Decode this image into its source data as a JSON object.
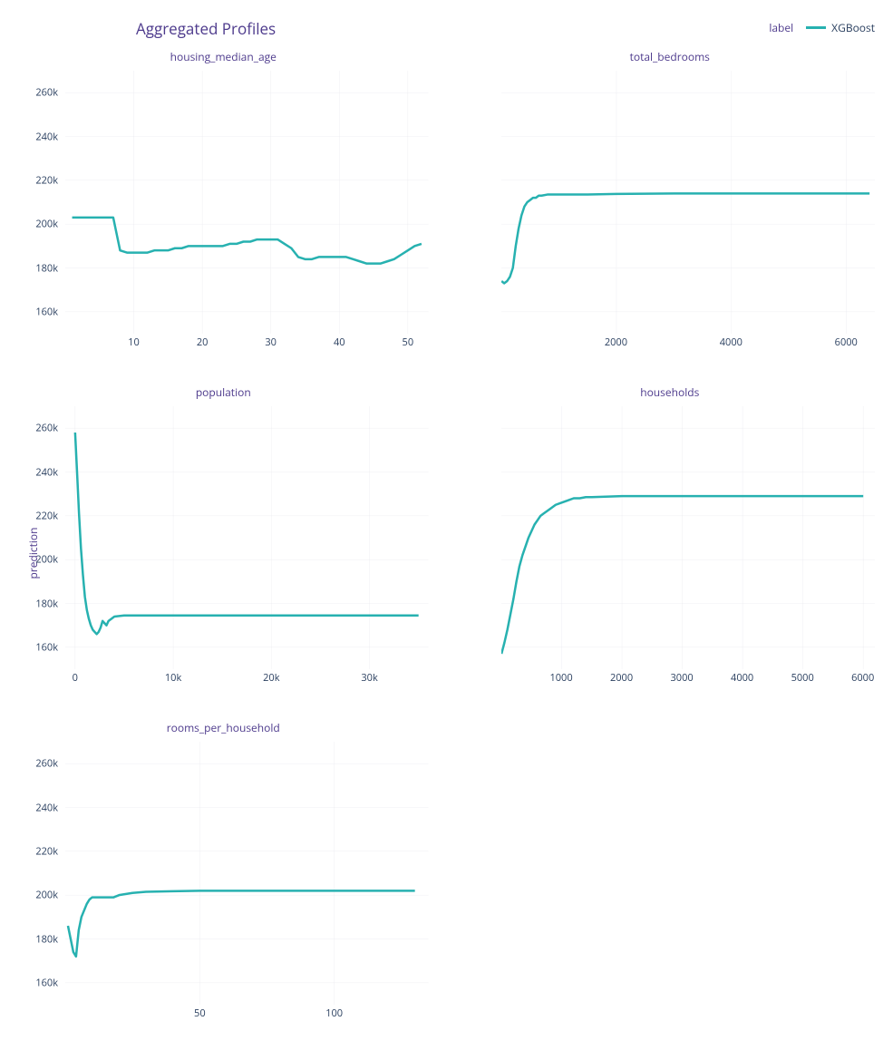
{
  "title": "Aggregated Profiles",
  "legend": {
    "title": "label",
    "items": [
      {
        "name": "XGBoost",
        "color": "#27b1b0"
      }
    ]
  },
  "y_axis_label": "prediction",
  "y_axis": {
    "ticks": [
      160000,
      180000,
      200000,
      220000,
      240000,
      260000
    ],
    "tick_labels": [
      "160k",
      "180k",
      "200k",
      "220k",
      "240k",
      "260k"
    ],
    "ylim": [
      150000,
      270000
    ]
  },
  "chart_data": [
    {
      "type": "line",
      "title": "housing_median_age",
      "x_ticks": [
        10,
        20,
        30,
        40,
        50
      ],
      "x_tick_labels": [
        "10",
        "20",
        "30",
        "40",
        "50"
      ],
      "xlim": [
        0,
        53
      ],
      "series": [
        {
          "name": "XGBoost",
          "x": [
            1,
            2,
            3,
            4,
            5,
            6,
            7,
            8,
            9,
            10,
            11,
            12,
            13,
            14,
            15,
            16,
            17,
            18,
            19,
            20,
            21,
            22,
            23,
            24,
            25,
            26,
            27,
            28,
            29,
            30,
            31,
            32,
            33,
            34,
            35,
            36,
            37,
            38,
            39,
            40,
            41,
            42,
            43,
            44,
            45,
            46,
            47,
            48,
            49,
            50,
            51,
            52
          ],
          "y": [
            203000,
            203000,
            203000,
            203000,
            203000,
            203000,
            203000,
            188000,
            187000,
            187000,
            187000,
            187000,
            188000,
            188000,
            188000,
            189000,
            189000,
            190000,
            190000,
            190000,
            190000,
            190000,
            190000,
            191000,
            191000,
            192000,
            192000,
            193000,
            193000,
            193000,
            193000,
            191000,
            189000,
            185000,
            184000,
            184000,
            185000,
            185000,
            185000,
            185000,
            185000,
            184000,
            183000,
            182000,
            182000,
            182000,
            183000,
            184000,
            186000,
            188000,
            190000,
            191000
          ]
        }
      ]
    },
    {
      "type": "line",
      "title": "total_bedrooms",
      "x_ticks": [
        2000,
        4000,
        6000
      ],
      "x_tick_labels": [
        "2000",
        "4000",
        "6000"
      ],
      "xlim": [
        0,
        6500
      ],
      "series": [
        {
          "name": "XGBoost",
          "x": [
            3,
            50,
            100,
            150,
            200,
            250,
            300,
            350,
            400,
            450,
            500,
            550,
            600,
            650,
            700,
            800,
            900,
            1000,
            1200,
            1500,
            2000,
            3000,
            4000,
            5000,
            6000,
            6400
          ],
          "y": [
            174000,
            173000,
            174000,
            176000,
            180000,
            190000,
            198000,
            204000,
            208000,
            210000,
            211000,
            212000,
            212000,
            213000,
            213000,
            213500,
            213500,
            213500,
            213500,
            213500,
            213800,
            214000,
            214000,
            214000,
            214000,
            214000
          ]
        }
      ]
    },
    {
      "type": "line",
      "title": "population",
      "x_ticks": [
        0,
        10000,
        20000,
        30000
      ],
      "x_tick_labels": [
        "0",
        "10k",
        "20k",
        "30k"
      ],
      "xlim": [
        -1000,
        36000
      ],
      "series": [
        {
          "name": "XGBoost",
          "x": [
            3,
            200,
            400,
            600,
            800,
            1000,
            1200,
            1400,
            1600,
            1800,
            2000,
            2200,
            2400,
            2600,
            2800,
            3000,
            3200,
            3400,
            4000,
            5000,
            6000,
            8000,
            10000,
            15000,
            20000,
            25000,
            30000,
            35000
          ],
          "y": [
            258000,
            240000,
            221000,
            205000,
            193000,
            183000,
            177000,
            173000,
            170000,
            168000,
            167000,
            166000,
            167000,
            169000,
            172000,
            171000,
            170000,
            172000,
            174000,
            174500,
            174500,
            174500,
            174500,
            174500,
            174500,
            174500,
            174500,
            174500
          ]
        }
      ]
    },
    {
      "type": "line",
      "title": "households",
      "x_ticks": [
        1000,
        2000,
        3000,
        4000,
        5000,
        6000
      ],
      "x_tick_labels": [
        "1000",
        "2000",
        "3000",
        "4000",
        "5000",
        "6000"
      ],
      "xlim": [
        0,
        6200
      ],
      "series": [
        {
          "name": "XGBoost",
          "x": [
            2,
            50,
            100,
            150,
            200,
            250,
            300,
            350,
            400,
            450,
            500,
            550,
            600,
            650,
            700,
            750,
            800,
            900,
            1000,
            1100,
            1200,
            1300,
            1400,
            1500,
            2000,
            3000,
            4000,
            5000,
            6000
          ],
          "y": [
            157000,
            162000,
            168000,
            175000,
            182000,
            190000,
            197000,
            202000,
            206000,
            210000,
            213000,
            216000,
            218000,
            220000,
            221000,
            222000,
            223000,
            225000,
            226000,
            227000,
            228000,
            228000,
            228500,
            228500,
            229000,
            229000,
            229000,
            229000,
            229000
          ]
        }
      ]
    },
    {
      "type": "line",
      "title": "rooms_per_household",
      "x_ticks": [
        50,
        100
      ],
      "x_tick_labels": [
        "50",
        "100"
      ],
      "xlim": [
        0,
        135
      ],
      "series": [
        {
          "name": "XGBoost",
          "x": [
            1,
            2,
            3,
            4,
            5,
            6,
            7,
            8,
            9,
            10,
            12,
            14,
            16,
            18,
            20,
            25,
            30,
            40,
            50,
            70,
            90,
            110,
            130
          ],
          "y": [
            186000,
            180000,
            174000,
            172000,
            184000,
            190000,
            193000,
            196000,
            198000,
            199000,
            199000,
            199000,
            199000,
            199000,
            200000,
            201000,
            201500,
            201800,
            202000,
            202000,
            202000,
            202000,
            202000
          ]
        }
      ]
    }
  ]
}
